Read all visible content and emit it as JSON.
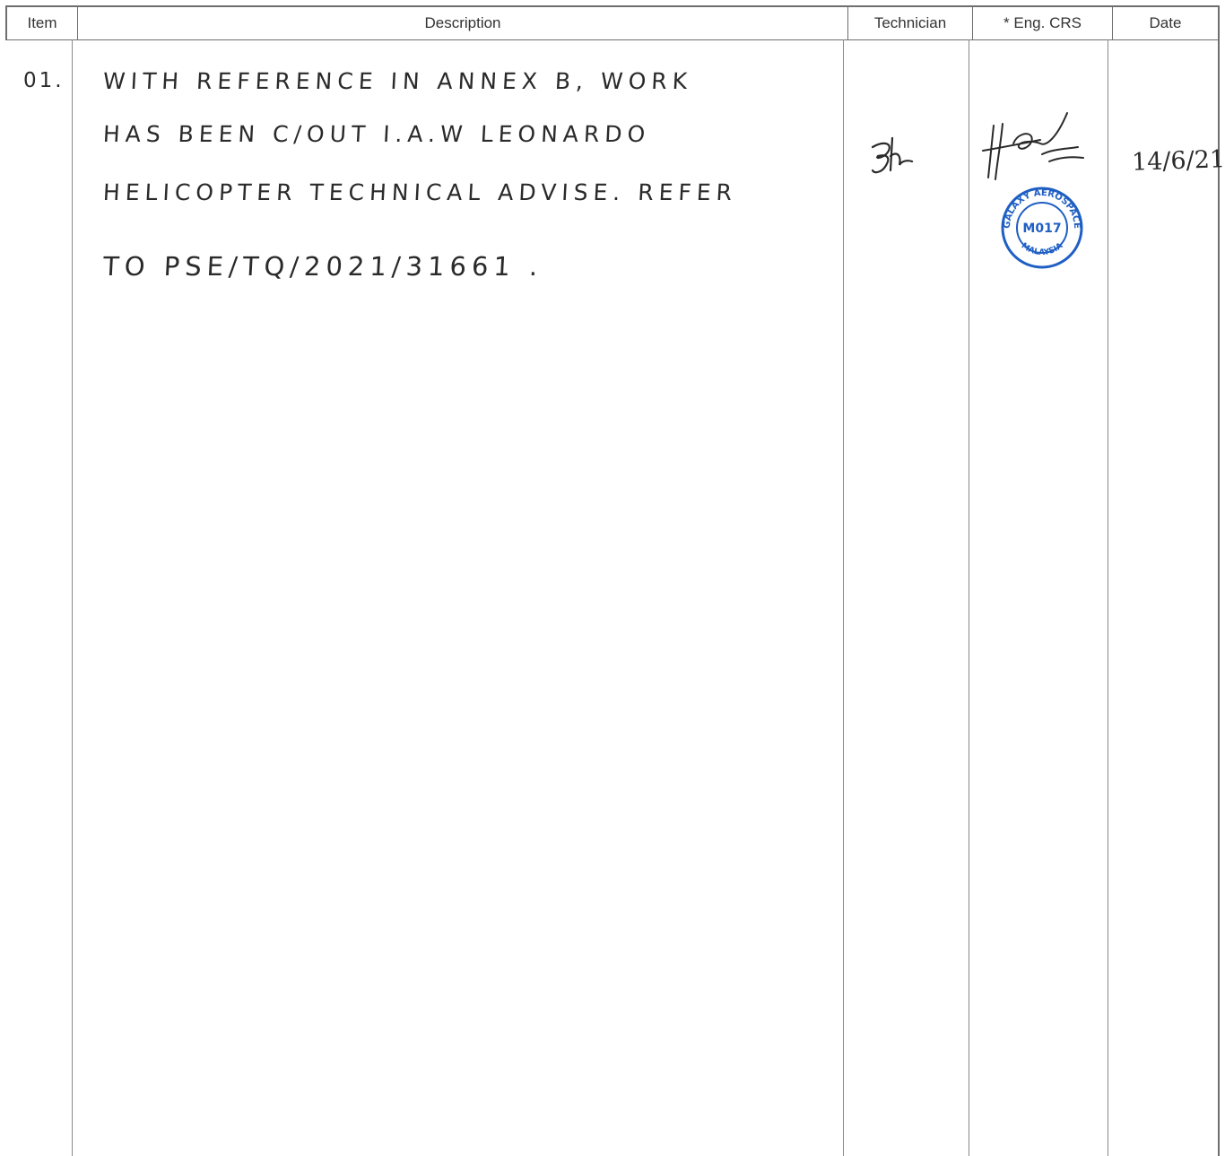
{
  "header": {
    "item": "Item",
    "description": "Description",
    "technician": "Technician",
    "eng_crs": "* Eng. CRS",
    "date": "Date"
  },
  "entries": [
    {
      "item": "01.",
      "description_lines": [
        "WITH  REFERENCE  IN  ANNEX B, WORK",
        "HAS BEEN  C/OUT  I.A.W  LEONARDO",
        "HELICOPTER  TECHNICAL  ADVISE. REFER",
        "TO  PSE/TQ/2021/31661 ."
      ],
      "date": "14/6/21",
      "stamp_text": {
        "top": "GALAXY AEROSPACE",
        "center": "M017",
        "bottom": "MALAYSIA"
      }
    }
  ],
  "colors": {
    "line": "#6e6e6e",
    "ink": "#2a2a2a",
    "stamp": "#1f5fc4"
  }
}
